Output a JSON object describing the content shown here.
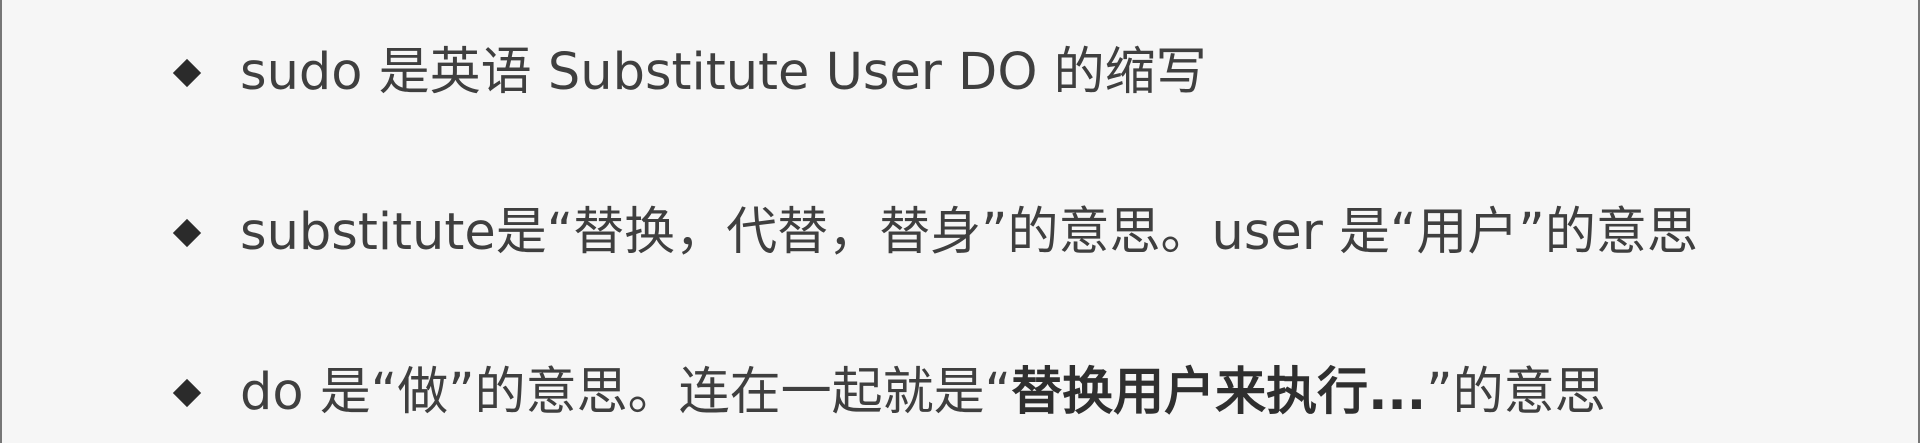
{
  "bullets": [
    {
      "text": "sudo 是英语 Substitute User DO 的缩写"
    },
    {
      "text": "substitute是“替换，代替，替身”的意思。user 是“用户”的意思"
    },
    {
      "prefix": "do 是“做”的意思。连在一起就是“",
      "emphasis": "替换用户来执行...",
      "suffix": "”的意思"
    }
  ],
  "colors": {
    "background": "#f6f6f6",
    "text": "#3f3f3f",
    "bullet": "#2b2b2b",
    "border": "#777777"
  },
  "icons": {
    "bullet": "diamond-bullet-icon"
  }
}
